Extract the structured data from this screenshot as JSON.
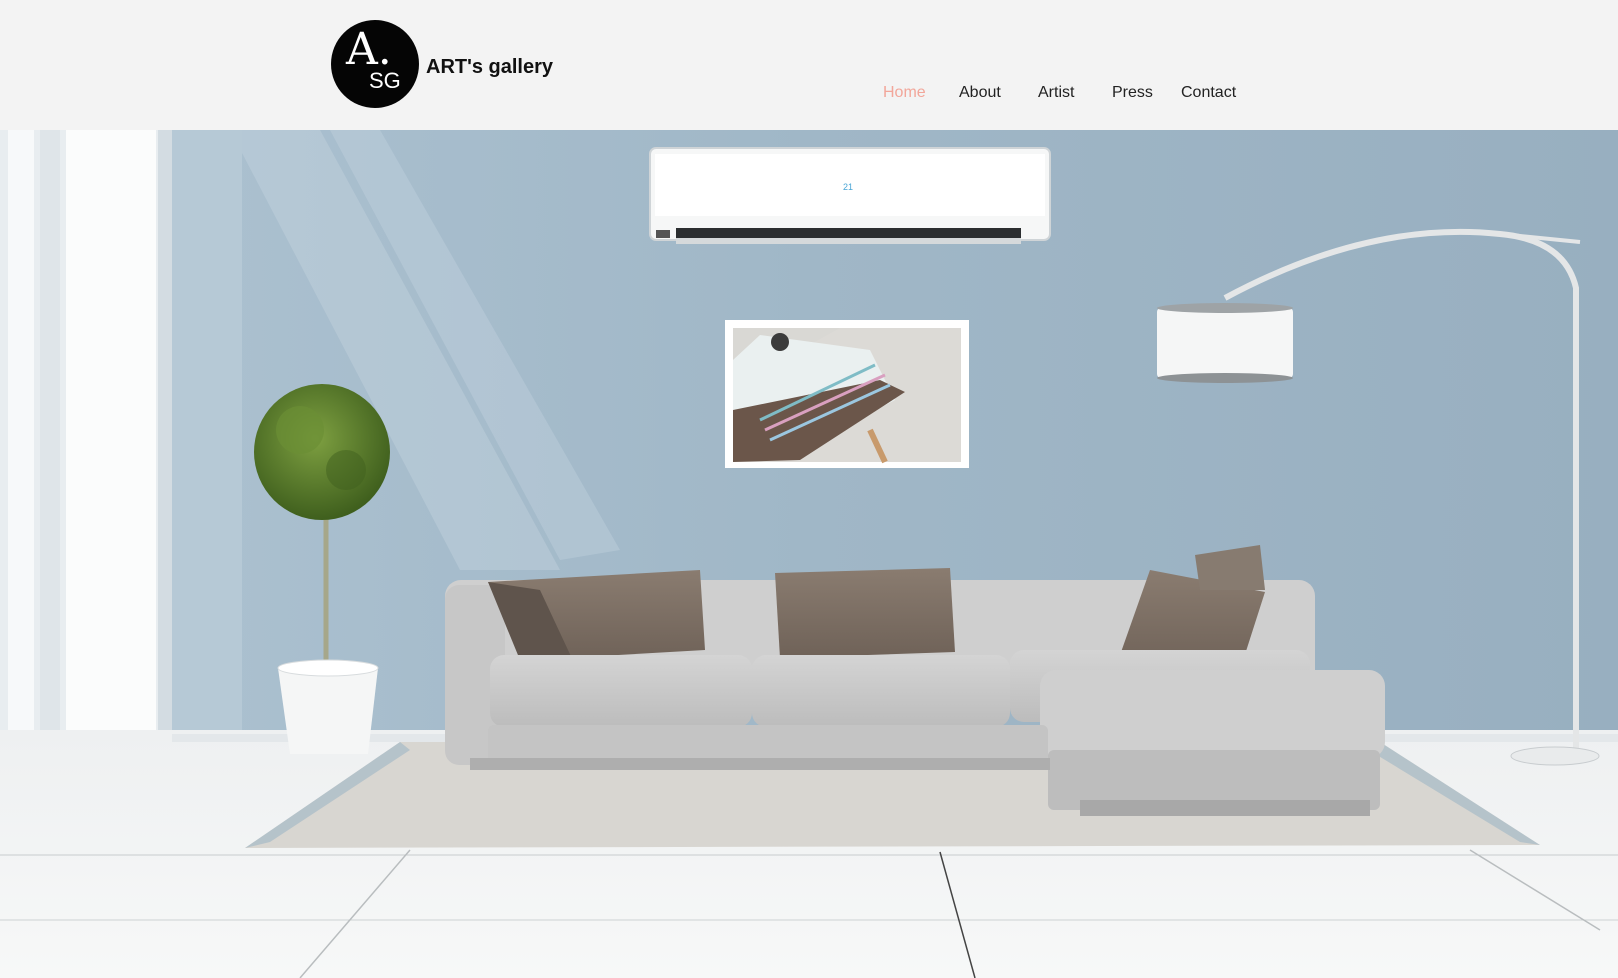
{
  "brand": {
    "logo_letter": "A.",
    "logo_sub": "SG",
    "title": "ART's gallery"
  },
  "nav": {
    "items": [
      {
        "label": "Home",
        "active": true
      },
      {
        "label": "About",
        "active": false
      },
      {
        "label": "Artist",
        "active": false
      },
      {
        "label": "Press",
        "active": false
      },
      {
        "label": "Contact",
        "active": false
      }
    ]
  },
  "hero": {
    "ac_display": "21"
  },
  "colors": {
    "background": "#f3f3f3",
    "nav_active": "#f2a69a",
    "nav_text": "#222222",
    "wall": "#9fb6c6",
    "logo": "#050505"
  }
}
